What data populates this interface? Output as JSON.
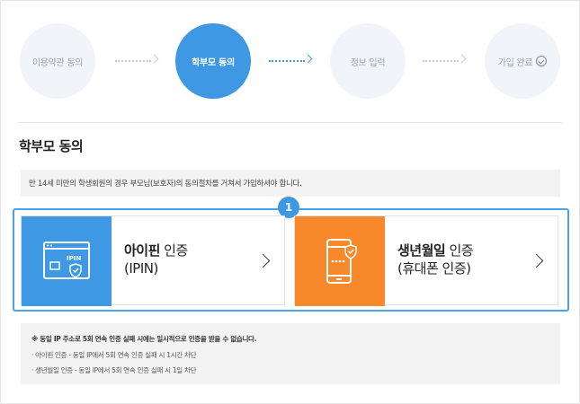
{
  "steps": [
    {
      "label": "이용약관 동의"
    },
    {
      "label": "학부모 동의"
    },
    {
      "label": "정보 입력"
    },
    {
      "label": "가입 완료"
    }
  ],
  "page_title": "학부모 동의",
  "notice": "만 14세 미만의 학생회원의 경우 부모님(보호자)의 동의절차를 거쳐서 가입하셔야 합니다.",
  "badge_number": "1",
  "cards": {
    "ipin": {
      "bold": "아이핀",
      "rest": " 인증",
      "sub": "(IPIN)",
      "icon_text": "IPIN",
      "color": "#3e98e4"
    },
    "phone": {
      "bold": "생년월일",
      "rest": " 인증",
      "sub": "(휴대폰 인증)",
      "color": "#f7892b"
    }
  },
  "info": {
    "warning": "※ 동일 IP 주소로 5회 연속 인증 실패 시에는 일시적으로 인증을 받을 수 없습니다.",
    "items": [
      "아이핀 인증 - 동일 IP에서 5회 연속 인증 실패 시 1시간 차단",
      "생년월일 인증 - 동일 IP에서 5회 연속 인증 실패 시 1일 차단"
    ]
  }
}
